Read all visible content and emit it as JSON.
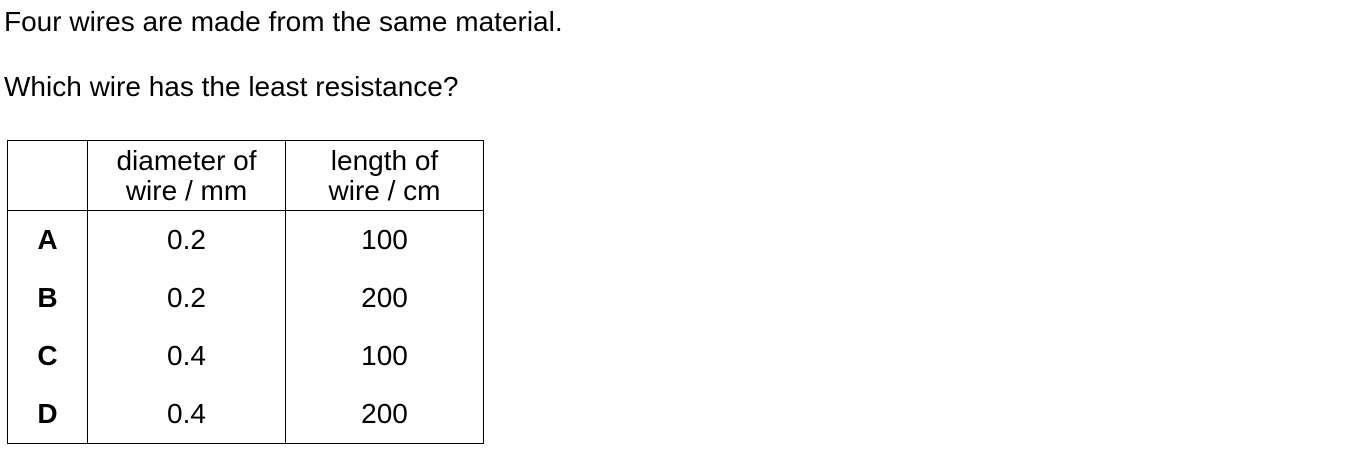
{
  "question": {
    "intro": "Four wires are made from the same material.",
    "prompt": "Which wire has the least resistance?"
  },
  "table": {
    "headers": {
      "label": "",
      "diameter_line1": "diameter of",
      "diameter_line2": "wire / mm",
      "length_line1": "length of",
      "length_line2": "wire / cm"
    },
    "rows": [
      {
        "label": "A",
        "diameter": "0.2",
        "length": "100"
      },
      {
        "label": "B",
        "diameter": "0.2",
        "length": "200"
      },
      {
        "label": "C",
        "diameter": "0.4",
        "length": "100"
      },
      {
        "label": "D",
        "diameter": "0.4",
        "length": "200"
      }
    ]
  }
}
